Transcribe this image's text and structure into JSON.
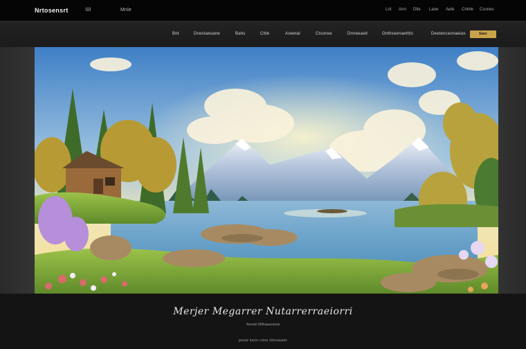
{
  "header": {
    "brand": "Nrtosensrt",
    "links": [
      "Sll",
      "Mnle"
    ],
    "utility": [
      "Lnt",
      "Arm",
      "Dtle",
      "Laoe",
      "Aete",
      "Cnlnle",
      "Csoneo"
    ]
  },
  "nav": {
    "items": [
      "Bnt",
      "Dnestaeuane",
      "Bahs",
      "Cttle",
      "Aoeetal",
      "Ctsonee",
      "Dnneeaeit",
      "Onthseenaetttls",
      "Deetenceonaeias"
    ],
    "cta": "Sanc"
  },
  "hero": {
    "image": "lakeside-cabin-mountain-landscape"
  },
  "footer": {
    "title": "Merjer Megarrer Nutarrerraeiorri",
    "subtitle": "Aenete Mtthaaasoieai",
    "links": "peele  kenn  rrtnn  ilmrseatet"
  },
  "colors": {
    "accent": "#c9a24a",
    "background": "#0b0b0b",
    "navbar": "#1f1f1f"
  }
}
